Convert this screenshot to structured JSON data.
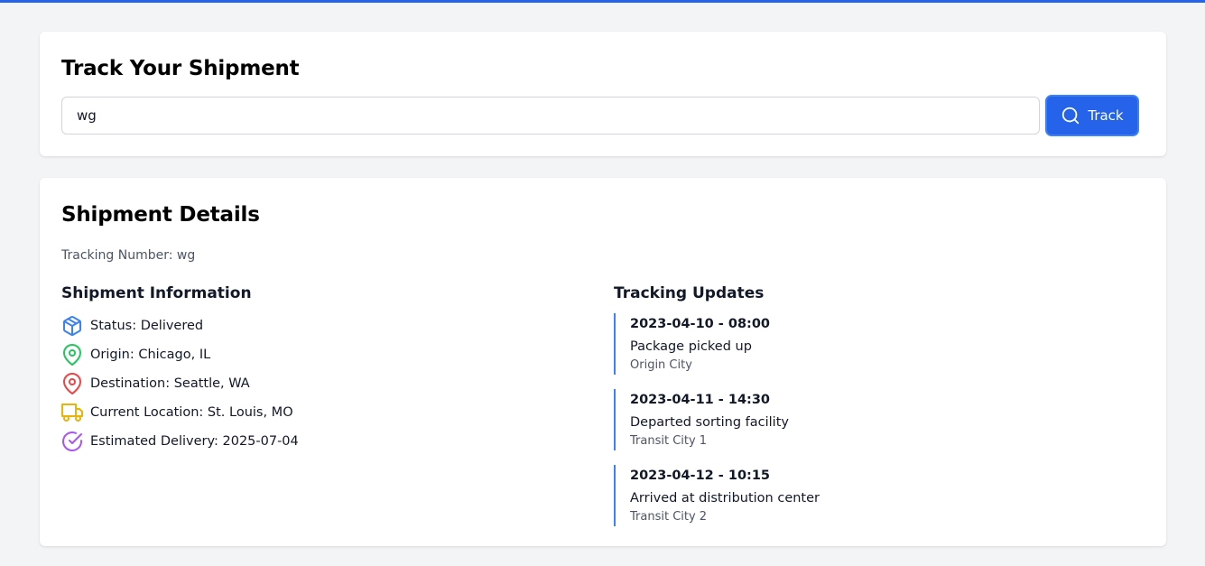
{
  "search": {
    "title": "Track Your Shipment",
    "input_value": "wg",
    "button_label": "Track",
    "button_icon": "search-icon"
  },
  "details": {
    "title": "Shipment Details",
    "tracking_number": "Tracking Number: wg",
    "info_title": "Shipment Information",
    "info": [
      {
        "icon": "package-icon",
        "color": "#3b82f6",
        "text": "Status: Delivered"
      },
      {
        "icon": "map-pin-icon",
        "color": "#22c55e",
        "text": "Origin: Chicago, IL"
      },
      {
        "icon": "map-pin-icon",
        "color": "#ef4444",
        "text": "Destination: Seattle, WA"
      },
      {
        "icon": "truck-icon",
        "color": "#eab308",
        "text": "Current Location: St. Louis, MO"
      },
      {
        "icon": "check-circle-icon",
        "color": "#a855f7",
        "text": "Estimated Delivery: 2025-07-04"
      }
    ],
    "updates_title": "Tracking Updates",
    "updates": [
      {
        "time": "2023-04-10 - 08:00",
        "description": "Package picked up",
        "location": "Origin City"
      },
      {
        "time": "2023-04-11 - 14:30",
        "description": "Departed sorting facility",
        "location": "Transit City 1"
      },
      {
        "time": "2023-04-12 - 10:15",
        "description": "Arrived at distribution center",
        "location": "Transit City 2"
      }
    ]
  },
  "colors": {
    "accent": "#2563eb",
    "timeline": "#3b82f6",
    "background": "#f3f4f6"
  }
}
